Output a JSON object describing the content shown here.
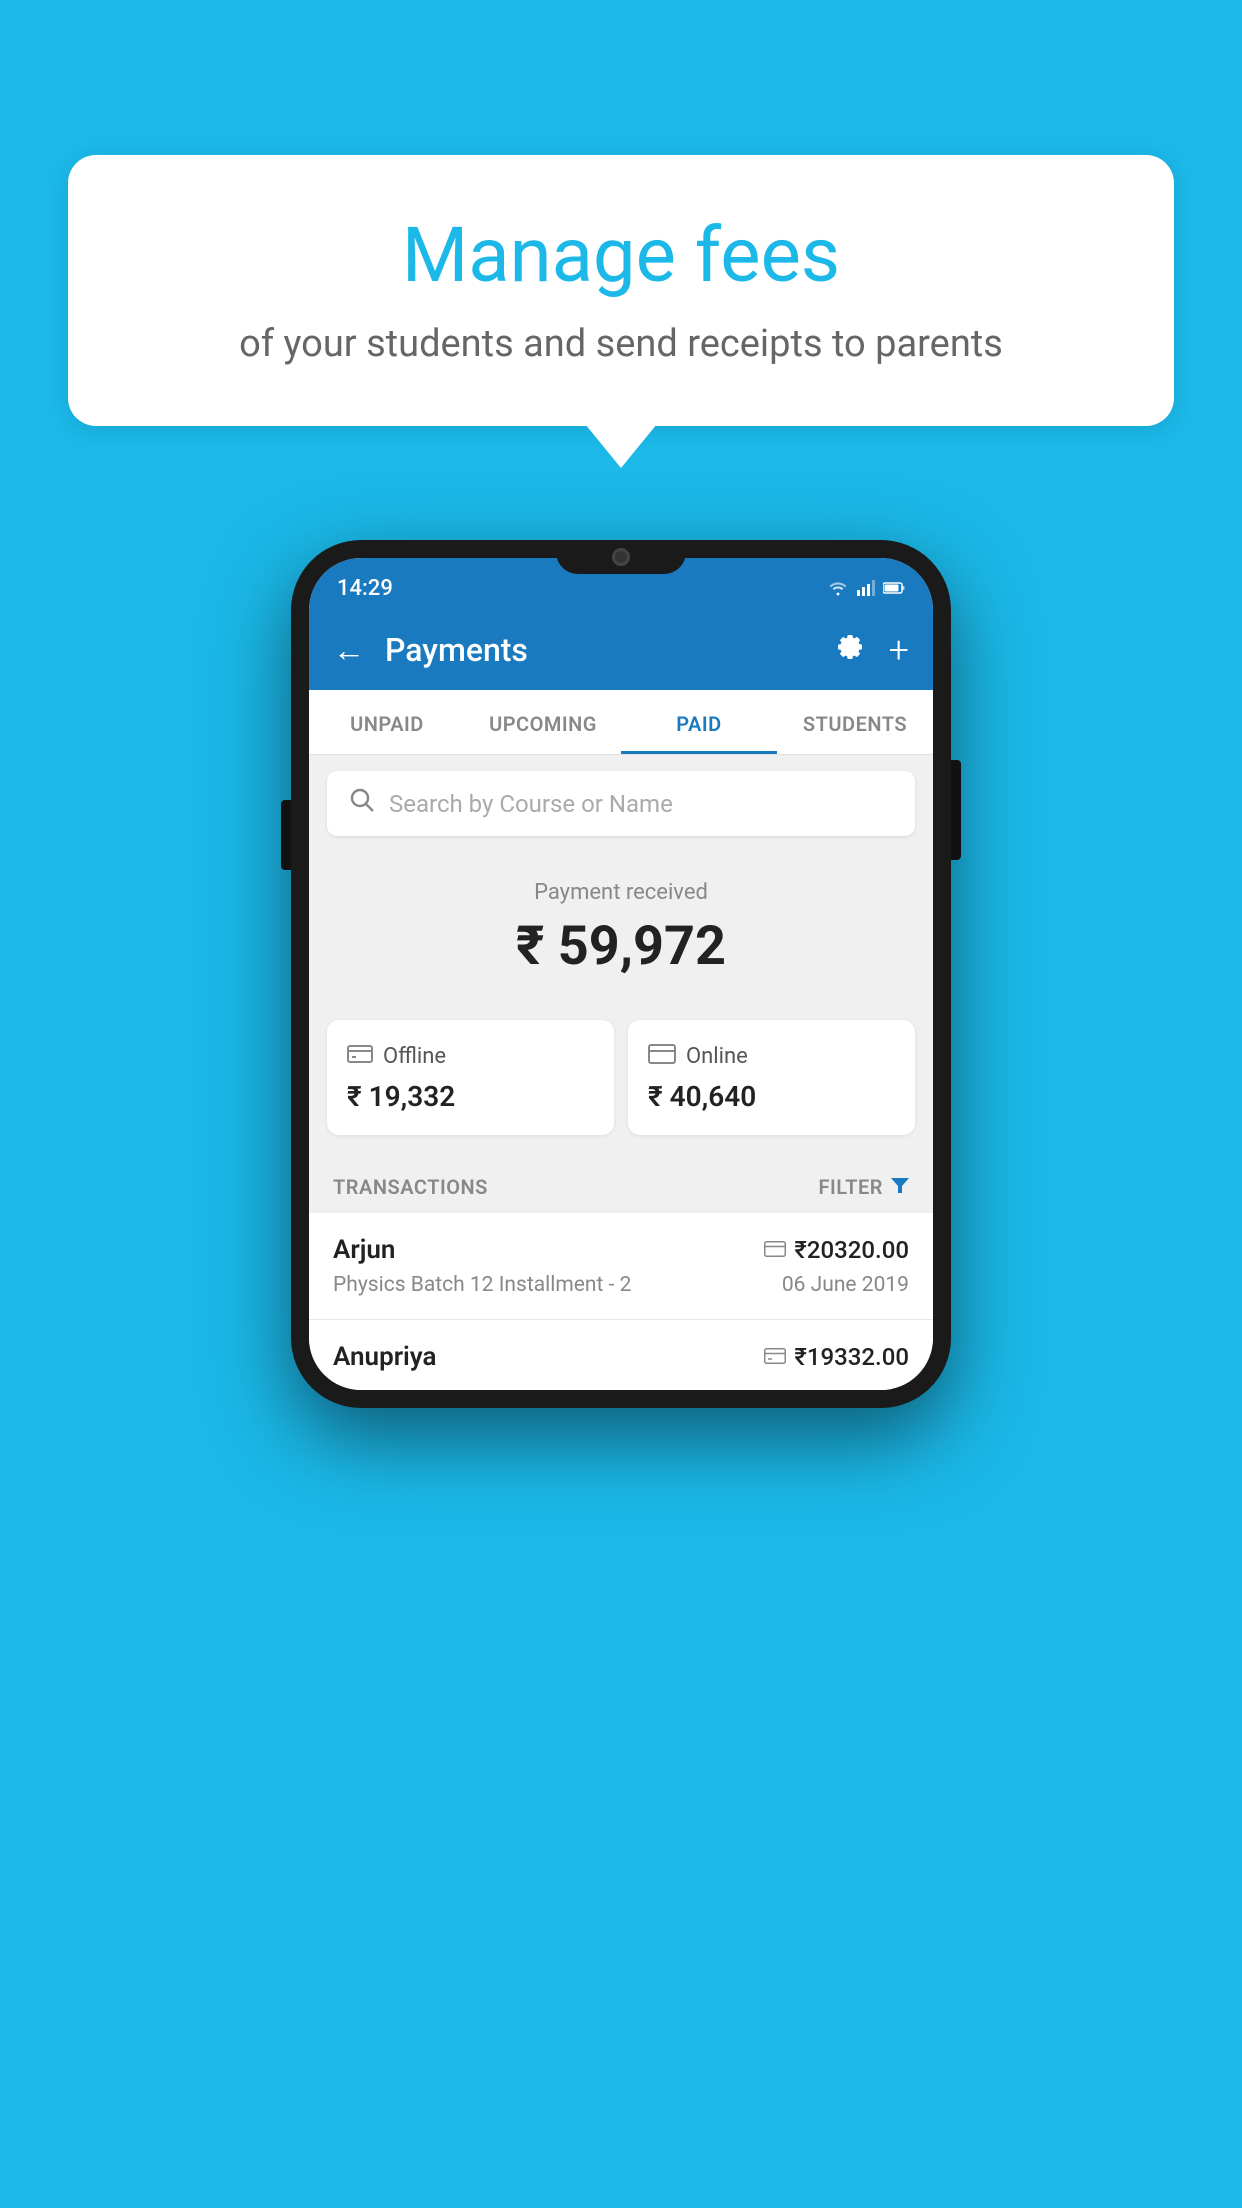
{
  "background_color": "#1bb8e8",
  "bubble": {
    "title": "Manage fees",
    "subtitle": "of your students and send receipts to parents"
  },
  "phone": {
    "status_bar": {
      "time": "14:29",
      "wifi": "▼▲",
      "signal": "▲▲",
      "battery": "▐"
    },
    "header": {
      "back_label": "←",
      "title": "Payments",
      "gear_label": "⚙",
      "plus_label": "+"
    },
    "tabs": [
      {
        "label": "UNPAID",
        "active": false
      },
      {
        "label": "UPCOMING",
        "active": false
      },
      {
        "label": "PAID",
        "active": true
      },
      {
        "label": "STUDENTS",
        "active": false
      }
    ],
    "search": {
      "placeholder": "Search by Course or Name"
    },
    "payment_received": {
      "label": "Payment received",
      "amount": "₹ 59,972"
    },
    "offline_card": {
      "type": "Offline",
      "amount": "₹ 19,332"
    },
    "online_card": {
      "type": "Online",
      "amount": "₹ 40,640"
    },
    "transactions_label": "TRANSACTIONS",
    "filter_label": "FILTER",
    "transactions": [
      {
        "name": "Arjun",
        "amount": "₹20320.00",
        "course": "Physics Batch 12 Installment - 2",
        "date": "06 June 2019",
        "payment_type": "online"
      },
      {
        "name": "Anupriya",
        "amount": "₹19332.00",
        "course": "",
        "date": "",
        "payment_type": "offline"
      }
    ]
  }
}
